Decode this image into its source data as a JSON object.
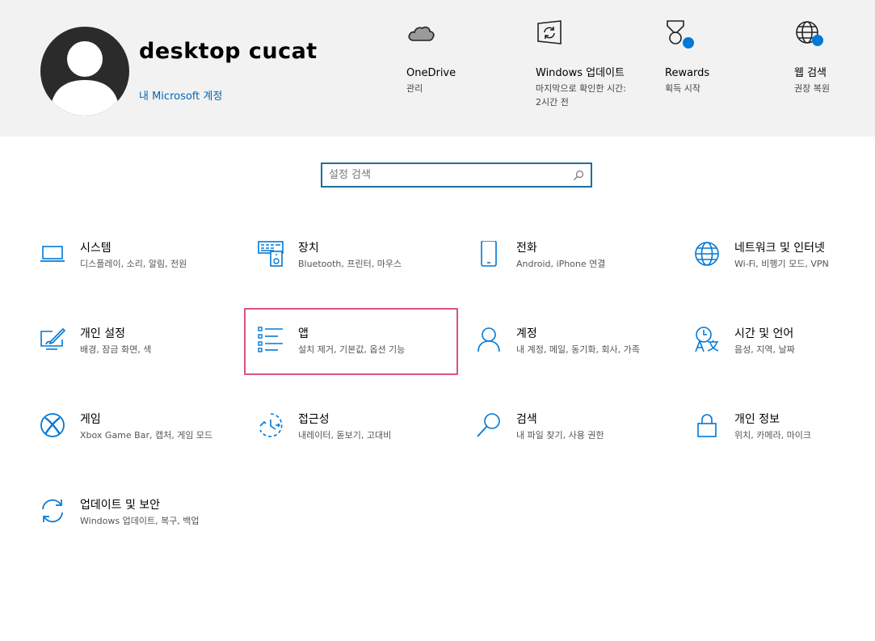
{
  "header": {
    "user_name": "desktop cucat",
    "account_link": "내 Microsoft 계정",
    "quick_links": [
      {
        "icon": "cloud-icon",
        "title": "OneDrive",
        "sub": "관리"
      },
      {
        "icon": "windows-update-icon",
        "title": "Windows 업데이트",
        "sub": "마지막으로 확인한 시간: 2시간 전"
      },
      {
        "icon": "rewards-medal-icon",
        "title": "Rewards",
        "sub": "획득 시작"
      },
      {
        "icon": "globe-icon",
        "title": "웹 검색",
        "sub": "권장 복원"
      }
    ]
  },
  "search": {
    "placeholder": "설정 검색"
  },
  "categories": [
    {
      "icon": "laptop-icon",
      "title": "시스템",
      "sub": "디스플레이, 소리, 알림, 전원"
    },
    {
      "icon": "devices-icon",
      "title": "장치",
      "sub": "Bluetooth, 프린터, 마우스"
    },
    {
      "icon": "phone-icon",
      "title": "전화",
      "sub": "Android, iPhone 연결"
    },
    {
      "icon": "network-globe-icon",
      "title": "네트워크 및 인터넷",
      "sub": "Wi-Fi, 비행기 모드, VPN"
    },
    {
      "icon": "personalization-icon",
      "title": "개인 설정",
      "sub": "배경, 잠금 화면, 색"
    },
    {
      "icon": "apps-list-icon",
      "title": "앱",
      "sub": "설치 제거, 기본값, 옵션 기능"
    },
    {
      "icon": "person-icon",
      "title": "계정",
      "sub": "내 계정, 메일, 동기화, 회사, 가족"
    },
    {
      "icon": "time-language-icon",
      "title": "시간 및 언어",
      "sub": "음성, 지역, 날짜"
    },
    {
      "icon": "xbox-icon",
      "title": "게임",
      "sub": "Xbox Game Bar, 캡처, 게임 모드"
    },
    {
      "icon": "ease-of-access-icon",
      "title": "접근성",
      "sub": "내레이터, 돋보기, 고대비"
    },
    {
      "icon": "search-magnifier-icon",
      "title": "검색",
      "sub": "내 파일 찾기, 사용 권한"
    },
    {
      "icon": "lock-icon",
      "title": "개인 정보",
      "sub": "위치, 카메라, 마이크"
    },
    {
      "icon": "update-security-icon",
      "title": "업데이트 및 보안",
      "sub": "Windows 업데이트, 복구, 백업"
    }
  ],
  "colors": {
    "accent": "#0078d7",
    "link": "#0067b8",
    "highlight": "#d9547a",
    "header_bg": "#f2f2f2"
  }
}
